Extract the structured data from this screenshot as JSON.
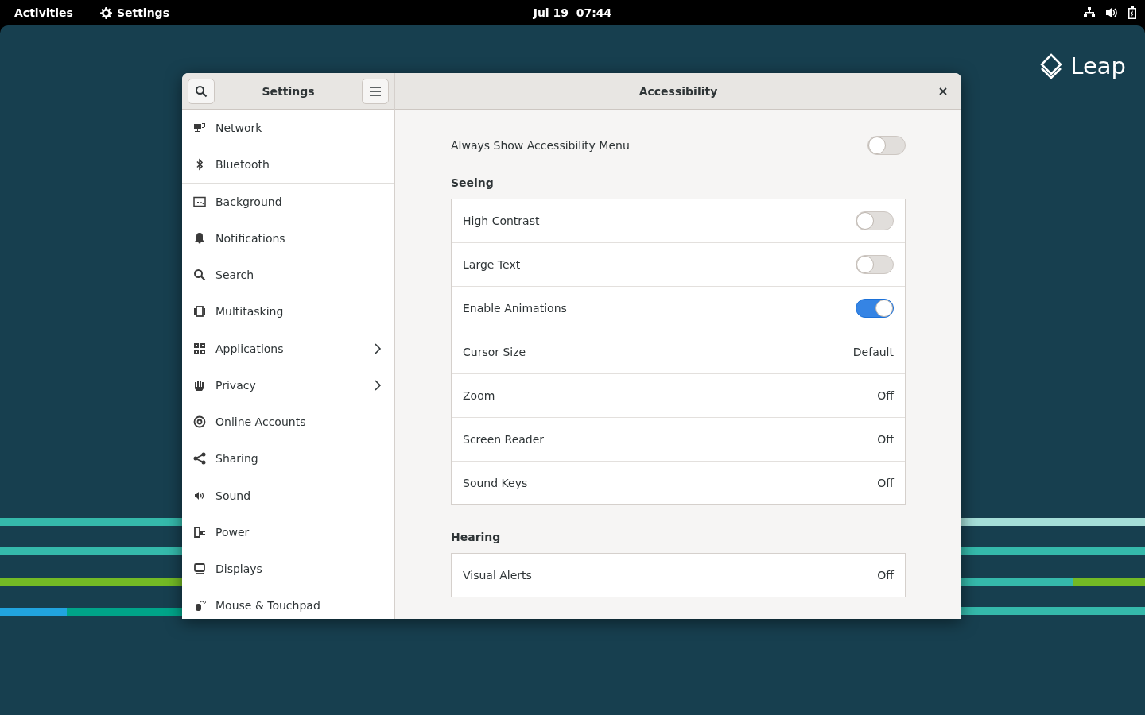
{
  "top_bar": {
    "activities": "Activities",
    "app_menu": "Settings",
    "clock": "Jul 19  07:44"
  },
  "desktop": {
    "logo_text": "Leap"
  },
  "window": {
    "sidebar_title": "Settings",
    "title": "Accessibility"
  },
  "sidebar": {
    "groups": [
      [
        {
          "label": "Network",
          "has_submenu": false
        },
        {
          "label": "Bluetooth",
          "has_submenu": false
        }
      ],
      [
        {
          "label": "Background",
          "has_submenu": false
        },
        {
          "label": "Notifications",
          "has_submenu": false
        },
        {
          "label": "Search",
          "has_submenu": false
        },
        {
          "label": "Multitasking",
          "has_submenu": false
        }
      ],
      [
        {
          "label": "Applications",
          "has_submenu": true
        },
        {
          "label": "Privacy",
          "has_submenu": true
        },
        {
          "label": "Online Accounts",
          "has_submenu": false
        },
        {
          "label": "Sharing",
          "has_submenu": false
        }
      ],
      [
        {
          "label": "Sound",
          "has_submenu": false
        },
        {
          "label": "Power",
          "has_submenu": false
        },
        {
          "label": "Displays",
          "has_submenu": false
        },
        {
          "label": "Mouse & Touchpad",
          "has_submenu": false
        }
      ]
    ]
  },
  "always_show_menu": {
    "label": "Always Show Accessibility Menu",
    "on": false
  },
  "sections": [
    {
      "title": "Seeing",
      "rows": [
        {
          "kind": "switch",
          "label": "High Contrast",
          "on": false
        },
        {
          "kind": "switch",
          "label": "Large Text",
          "on": false
        },
        {
          "kind": "switch",
          "label": "Enable Animations",
          "on": true
        },
        {
          "kind": "value",
          "label": "Cursor Size",
          "value": "Default"
        },
        {
          "kind": "value",
          "label": "Zoom",
          "value": "Off"
        },
        {
          "kind": "value",
          "label": "Screen Reader",
          "value": "Off"
        },
        {
          "kind": "value",
          "label": "Sound Keys",
          "value": "Off"
        }
      ]
    },
    {
      "title": "Hearing",
      "rows": [
        {
          "kind": "value",
          "label": "Visual Alerts",
          "value": "Off"
        }
      ]
    }
  ]
}
